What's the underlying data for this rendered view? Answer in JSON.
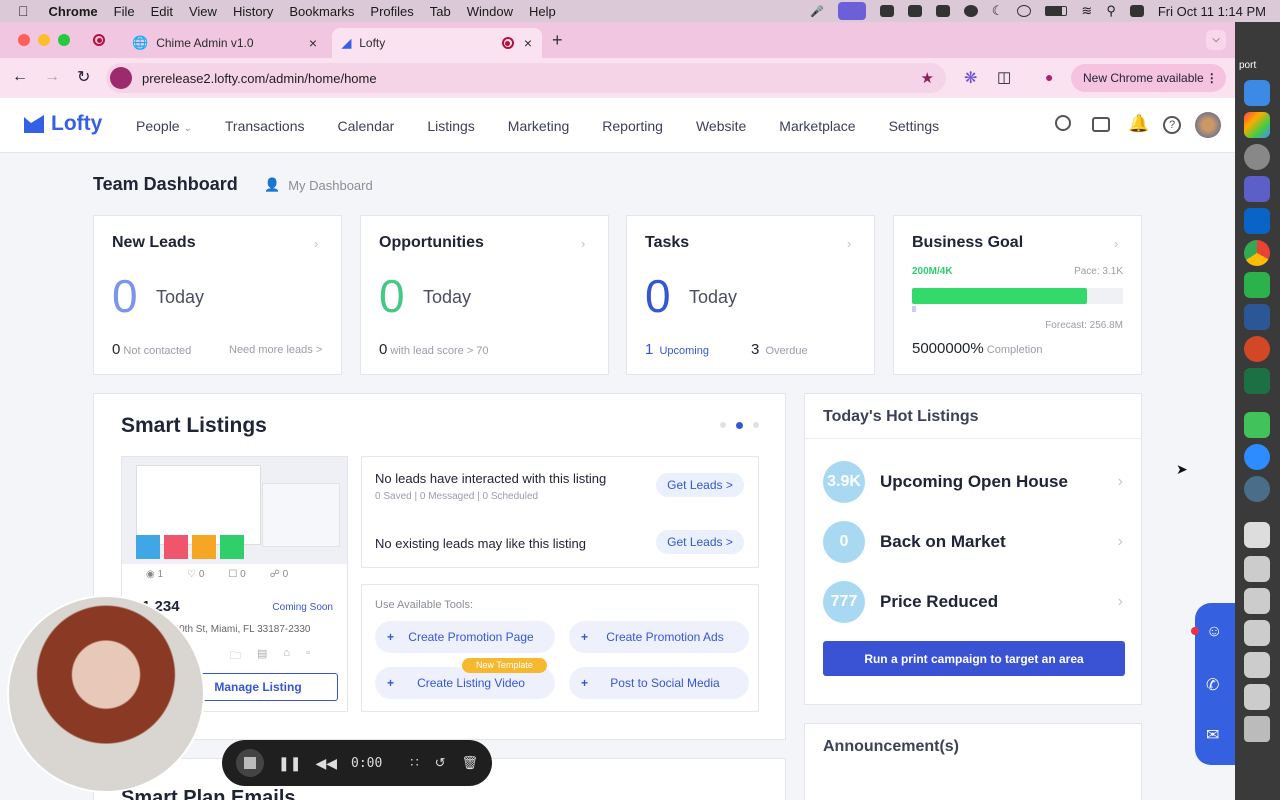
{
  "menubar": {
    "app": "Chrome",
    "items": [
      "File",
      "Edit",
      "View",
      "History",
      "Bookmarks",
      "Profiles",
      "Tab",
      "Window",
      "Help"
    ],
    "datetime": "Fri Oct 11  1:14 PM"
  },
  "browser": {
    "tabs": [
      {
        "title": "Chime Admin v1.0"
      },
      {
        "title": "Lofty"
      }
    ],
    "url": "prerelease2.lofty.com/admin/home/home",
    "new_chrome": "New Chrome available",
    "dock_peek": "port"
  },
  "nav": {
    "brand": "Lofty",
    "items": [
      "People",
      "Transactions",
      "Calendar",
      "Listings",
      "Marketing",
      "Reporting",
      "Website",
      "Marketplace",
      "Settings"
    ]
  },
  "dashboard": {
    "title": "Team Dashboard",
    "tab2": "My Dashboard"
  },
  "kpis": {
    "new_leads": {
      "title": "New Leads",
      "value": "0",
      "period": "Today",
      "sub_value": "0",
      "sub_label": "Not contacted",
      "link": "Need more leads >"
    },
    "opportunities": {
      "title": "Opportunities",
      "value": "0",
      "period": "Today",
      "sub_value": "0",
      "sub_label": "with lead score > 70"
    },
    "tasks": {
      "title": "Tasks",
      "value": "0",
      "period": "Today",
      "upcoming_value": "1",
      "upcoming_label": "Upcoming",
      "overdue_value": "3",
      "overdue_label": "Overdue"
    },
    "goal": {
      "title": "Business Goal",
      "progress_label": "200M/4K",
      "pace": "Pace: 3.1K",
      "progress": 0.83,
      "forecast": "Forecast: 256.8M",
      "completion_value": "5000000%",
      "completion_label": "Completion"
    }
  },
  "smart_listings": {
    "title": "Smart Listings",
    "price": "1,234",
    "status": "Coming Soon",
    "address": "200th St, Miami, FL 33187-2330",
    "stats": [
      "1",
      "0",
      "0",
      "0"
    ],
    "manage": "Manage Listing",
    "lead_row1": "No leads have interacted with this listing",
    "lead_row1_sub": "0 Saved | 0 Messaged | 0 Scheduled",
    "lead_row2": "No existing leads may like this listing",
    "get_leads": "Get Leads >",
    "tools_label": "Use Available Tools:",
    "tools": [
      "Create Promotion Page",
      "Create Promotion Ads",
      "Create Listing Video",
      "Post to Social Media"
    ],
    "new_template": "New Template"
  },
  "hot": {
    "title": "Today's Hot Listings",
    "items": [
      {
        "count": "3.9K",
        "label": "Upcoming Open House"
      },
      {
        "count": "0",
        "label": "Back on Market"
      },
      {
        "count": "777",
        "label": "Price Reduced"
      }
    ],
    "cta": "Run a print campaign to target an area"
  },
  "announcements": {
    "title": "Announcement(s)"
  },
  "smart_plan": {
    "title": "Smart Plan Emails"
  },
  "recorder": {
    "time": "0:00"
  },
  "colors": {
    "brand": "#3460e6",
    "green": "#2ecc71",
    "cta": "#3a52d4",
    "accent": "#3557d2"
  }
}
